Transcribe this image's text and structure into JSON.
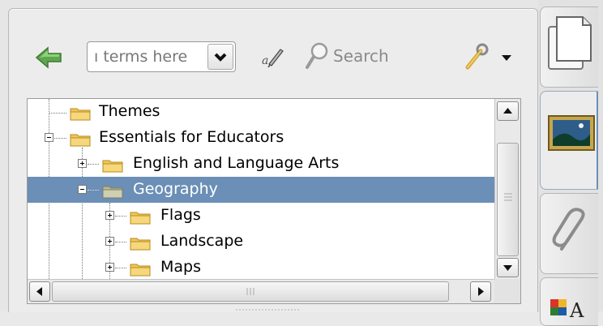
{
  "toolbar": {
    "search_placeholder": "ı terms here",
    "search_label": "Search"
  },
  "tree": {
    "rows": [
      {
        "label": "Themes",
        "depth": 0,
        "expander": "none",
        "selected": false
      },
      {
        "label": "Essentials for Educators",
        "depth": 0,
        "expander": "minus",
        "selected": false
      },
      {
        "label": "English and Language Arts",
        "depth": 1,
        "expander": "plus",
        "selected": false
      },
      {
        "label": "Geography",
        "depth": 1,
        "expander": "minus",
        "selected": true
      },
      {
        "label": "Flags",
        "depth": 2,
        "expander": "plus",
        "selected": false
      },
      {
        "label": "Landscape",
        "depth": 2,
        "expander": "plus",
        "selected": false
      },
      {
        "label": "Maps",
        "depth": 2,
        "expander": "plus",
        "selected": false
      }
    ]
  },
  "side_tabs": [
    {
      "name": "tab-page-sorter",
      "icon": "blank-page-icon"
    },
    {
      "name": "tab-gallery",
      "icon": "landscape-picture-icon",
      "active": true
    },
    {
      "name": "tab-attachments",
      "icon": "paperclip-icon"
    },
    {
      "name": "tab-properties",
      "icon": "properties-icon"
    }
  ],
  "colors": {
    "selection": "#6b8fb6",
    "folder": "#f2c75a",
    "back_arrow": "#5da64e"
  }
}
